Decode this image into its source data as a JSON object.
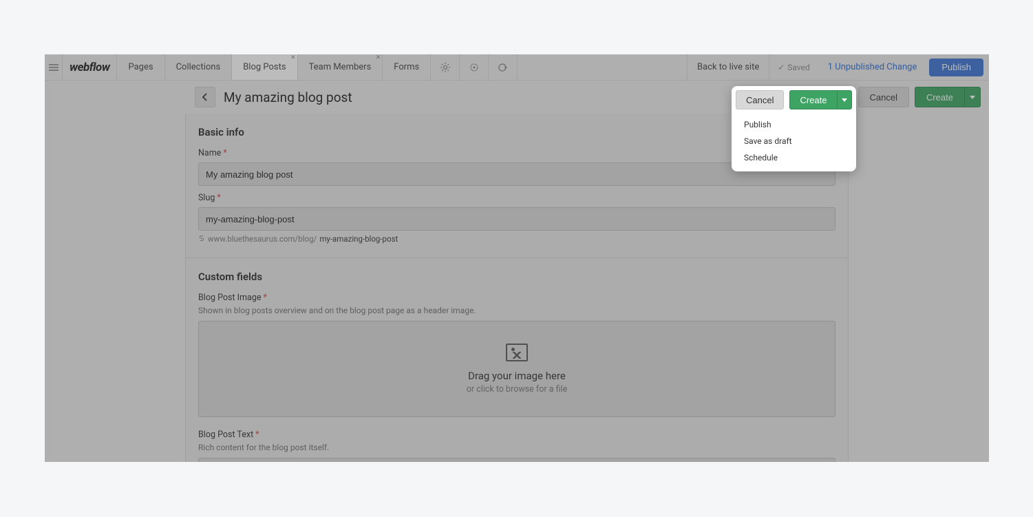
{
  "logo": "webflow",
  "tabs": {
    "pages": "Pages",
    "collections": "Collections",
    "blogposts": "Blog Posts",
    "teammembers": "Team Members",
    "forms": "Forms"
  },
  "topbarRight": {
    "back": "Back to live site",
    "saved": "Saved",
    "unpublished": "1 Unpublished Change",
    "publish": "Publish"
  },
  "pageHeader": {
    "title": "My amazing blog post",
    "cancel": "Cancel",
    "create": "Create"
  },
  "dropdown": {
    "publish": "Publish",
    "saveDraft": "Save as draft",
    "schedule": "Schedule"
  },
  "basic": {
    "section": "Basic info",
    "nameLabel": "Name",
    "nameValue": "My amazing blog post",
    "slugLabel": "Slug",
    "slugValue": "my-amazing-blog-post",
    "urlPrefix": "www.bluethesaurus.com/blog/",
    "urlSlug": "my-amazing-blog-post"
  },
  "custom": {
    "section": "Custom fields",
    "imageLabel": "Blog Post Image",
    "imageHelp": "Shown in blog posts overview and on the blog post page as a header image.",
    "dropText1": "Drag your image here",
    "dropText2": "or click to browse for a file",
    "textLabel": "Blog Post Text",
    "textHelp": "Rich content for the blog post itself."
  }
}
